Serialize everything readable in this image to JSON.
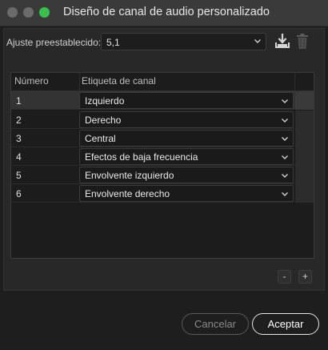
{
  "window": {
    "title": "Diseño de canal de audio personalizado"
  },
  "preset": {
    "label": "Ajuste preestablecido:",
    "value": "5,1"
  },
  "icons": {
    "download": "download-icon",
    "trash": "trash-icon",
    "chevron": "chevron-down-icon"
  },
  "table": {
    "headers": {
      "number": "Número",
      "label": "Etiqueta de canal"
    },
    "rows": [
      {
        "number": "1",
        "label": "Izquierdo",
        "selected": true
      },
      {
        "number": "2",
        "label": "Derecho",
        "selected": false
      },
      {
        "number": "3",
        "label": "Central",
        "selected": false
      },
      {
        "number": "4",
        "label": "Efectos de baja frecuencia",
        "selected": false
      },
      {
        "number": "5",
        "label": "Envolvente izquierdo",
        "selected": false
      },
      {
        "number": "6",
        "label": "Envolvente derecho",
        "selected": false
      }
    ]
  },
  "controls": {
    "minus": "-",
    "plus": "+"
  },
  "buttons": {
    "cancel": "Cancelar",
    "accept": "Aceptar"
  },
  "colors": {
    "accept_border": "#e6e6e6",
    "window_green": "#36c24a"
  }
}
